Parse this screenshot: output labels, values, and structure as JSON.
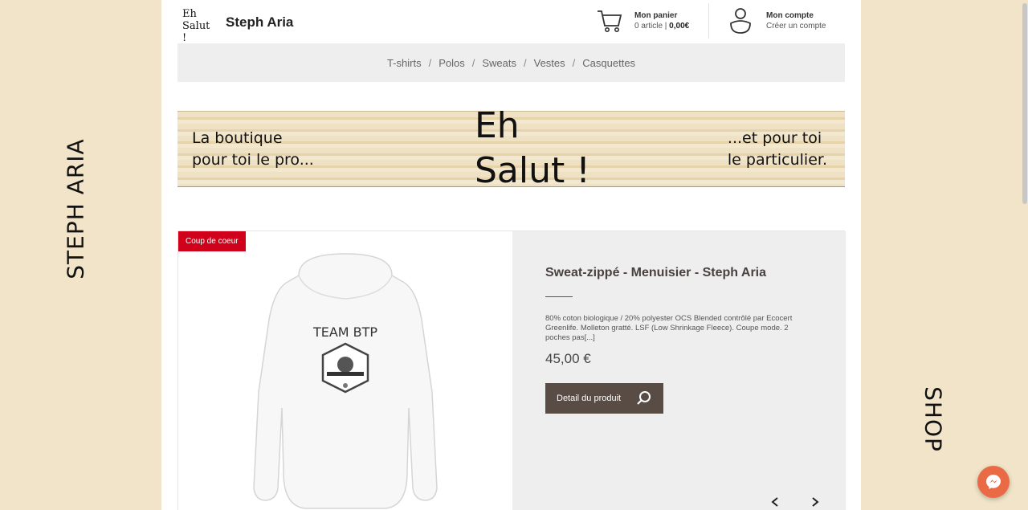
{
  "side": {
    "left_label": "STEPH ARIA",
    "right_label": "SHOP"
  },
  "header": {
    "logo_line1": "Eh",
    "logo_line2": "Salut !",
    "brand": "Steph Aria",
    "cart": {
      "title": "Mon panier",
      "count": "0 article",
      "separator": " | ",
      "total": "0,00€"
    },
    "account": {
      "title": "Mon compte",
      "link": "Créer un compte"
    }
  },
  "nav": {
    "items": [
      "T-shirts",
      "Polos",
      "Sweats",
      "Vestes",
      "Casquettes"
    ],
    "separator": "/"
  },
  "banner": {
    "left_line1": "La boutique",
    "left_line2": "pour toi le pro...",
    "center_line1": "Eh",
    "center_line2": "Salut !",
    "right_line1": "...et pour toi",
    "right_line2": "le particulier."
  },
  "product": {
    "badge": "Coup de coeur",
    "print_text": "TEAM BTP",
    "title": "Sweat-zippé - Menuisier - Steph Aria",
    "description": "80% coton biologique / 20% polyester OCS Blended contrôlé par Ecocert Greenlife. Molleton gratté. LSF (Low Shrinkage Fleece). Coupe mode. 2 poches pas[...]",
    "price": "45,00 €",
    "button_label": "Detail du produit"
  },
  "icons": {
    "cart": "cart-icon",
    "account": "user-icon",
    "search": "search-icon",
    "prev": "chevron-left-icon",
    "next": "chevron-right-icon",
    "messenger": "messenger-icon"
  },
  "colors": {
    "background": "#f1e4c8",
    "badge": "#d0021b",
    "button": "#584c45",
    "messenger": "#ea6a45"
  }
}
